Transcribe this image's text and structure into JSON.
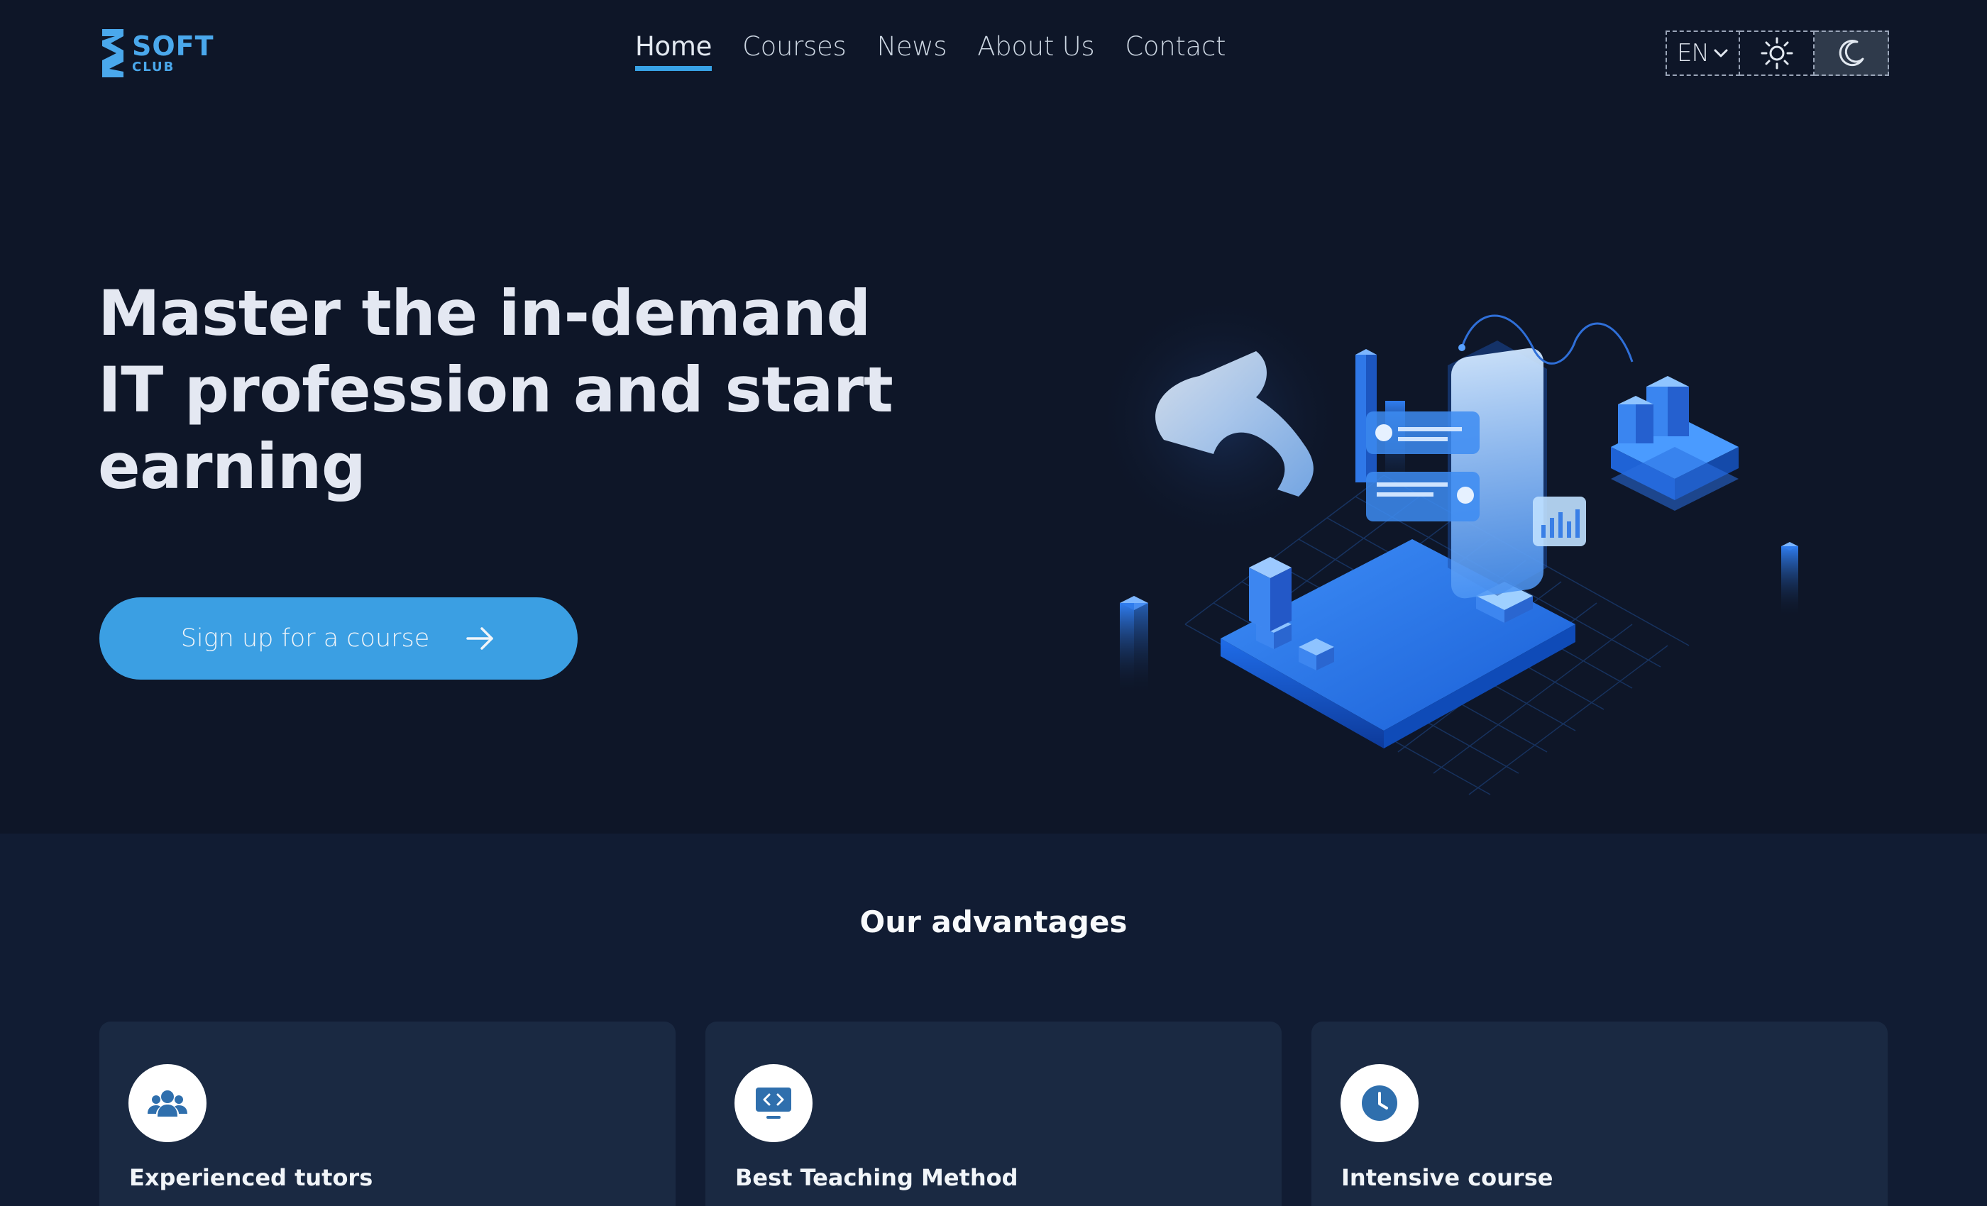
{
  "header": {
    "logo": {
      "text_top": "SOFT",
      "text_bottom": "CLUB"
    },
    "nav": [
      {
        "label": "Home",
        "active": true
      },
      {
        "label": "Courses",
        "active": false
      },
      {
        "label": "News",
        "active": false
      },
      {
        "label": "About Us",
        "active": false
      },
      {
        "label": "Contact",
        "active": false
      }
    ],
    "language": "EN",
    "icons": {
      "language_dropdown": "chevron-down-icon",
      "light_theme": "sun-icon",
      "dark_theme": "moon-icon"
    }
  },
  "hero": {
    "title": "Master the in-demand IT profession and start earning",
    "cta_label": "Sign up for a course",
    "cta_icon": "arrow-right-icon",
    "illustration": "isometric-tech-illustration"
  },
  "advantages": {
    "title": "Our advantages",
    "cards": [
      {
        "title": "Experienced tutors",
        "icon": "users-icon"
      },
      {
        "title": "Best Teaching Method",
        "icon": "monitor-code-icon"
      },
      {
        "title": "Intensive course",
        "icon": "clock-icon"
      }
    ]
  },
  "colors": {
    "page_bg": "#0e1628",
    "section_bg": "#111c33",
    "card_bg": "#1a2942",
    "accent": "#3b9fe3",
    "icon_blue": "#2f6fad"
  }
}
